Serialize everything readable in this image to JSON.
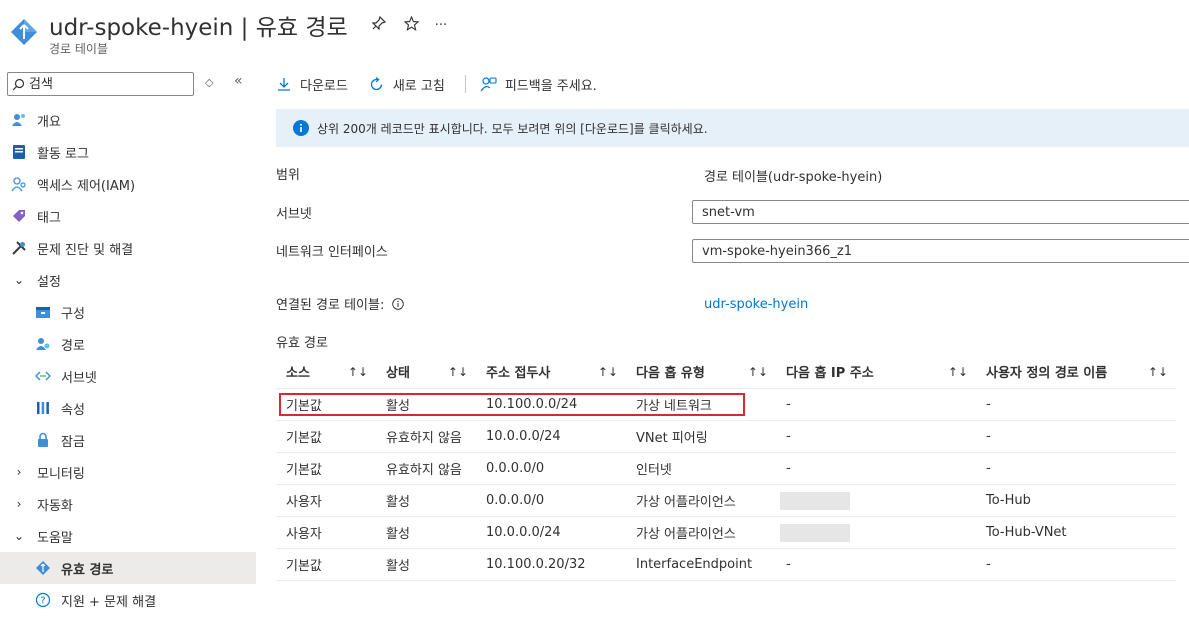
{
  "header": {
    "title": "udr-spoke-hyein | 유효 경로",
    "subtitle": "경로 테이블",
    "pin_icon": "pin-icon",
    "favorite_icon": "star-icon",
    "more": "···"
  },
  "sidebar": {
    "search_placeholder": "검색",
    "collapse": "«",
    "expand_toggle": "◇",
    "items": [
      {
        "label": "개요",
        "icon": "overview-icon",
        "kind": "top"
      },
      {
        "label": "활동 로그",
        "icon": "activity-log-icon",
        "kind": "top"
      },
      {
        "label": "액세스 제어(IAM)",
        "icon": "iam-icon",
        "kind": "top"
      },
      {
        "label": "태그",
        "icon": "tag-icon",
        "kind": "top"
      },
      {
        "label": "문제 진단 및 해결",
        "icon": "wrench-icon",
        "kind": "top"
      },
      {
        "label": "설정",
        "icon": "chevron-down-icon",
        "kind": "group"
      },
      {
        "label": "구성",
        "icon": "config-icon",
        "kind": "sub"
      },
      {
        "label": "경로",
        "icon": "routes-icon",
        "kind": "sub"
      },
      {
        "label": "서브넷",
        "icon": "subnet-icon",
        "kind": "sub"
      },
      {
        "label": "속성",
        "icon": "properties-icon",
        "kind": "sub"
      },
      {
        "label": "잠금",
        "icon": "lock-icon",
        "kind": "sub"
      },
      {
        "label": "모니터링",
        "icon": "chevron-right-icon",
        "kind": "group"
      },
      {
        "label": "자동화",
        "icon": "chevron-right-icon",
        "kind": "group"
      },
      {
        "label": "도움말",
        "icon": "chevron-down-icon",
        "kind": "group"
      },
      {
        "label": "유효 경로",
        "icon": "effective-routes-icon",
        "kind": "sub",
        "active": true
      },
      {
        "label": "지원 + 문제 해결",
        "icon": "help-icon",
        "kind": "sub"
      }
    ]
  },
  "toolbar": {
    "download": "다운로드",
    "refresh": "새로 고침",
    "feedback": "피드백을 주세요."
  },
  "info": {
    "text": "상위 200개 레코드만 표시합니다. 모두 보려면 위의 [다운로드]를 클릭하세요."
  },
  "form": {
    "scope_label": "범위",
    "scope_value": "경로 테이블(udr-spoke-hyein)",
    "subnet_label": "서브넷",
    "subnet_value": "snet-vm",
    "nic_label": "네트워크 인터페이스",
    "nic_value": "vm-spoke-hyein366_z1",
    "linked_label": "연결된 경로 테이블:",
    "linked_value": "udr-spoke-hyein",
    "section_title": "유효 경로"
  },
  "table": {
    "columns": [
      "소스",
      "상태",
      "주소 접두사",
      "다음 홉 유형",
      "다음 홉 IP 주소",
      "사용자 정의 경로 이름"
    ],
    "sort_glyph": "↑↓",
    "rows": [
      {
        "source": "기본값",
        "state": "활성",
        "prefix": "10.100.0.0/24",
        "next_hop_type": "가상 네트워크",
        "next_hop_ip": "-",
        "udr_name": "-",
        "redacted": false
      },
      {
        "source": "기본값",
        "state": "유효하지 않음",
        "prefix": "10.0.0.0/24",
        "next_hop_type": "VNet 피어링",
        "next_hop_ip": "-",
        "udr_name": "-",
        "redacted": false
      },
      {
        "source": "기본값",
        "state": "유효하지 않음",
        "prefix": "0.0.0.0/0",
        "next_hop_type": "인터넷",
        "next_hop_ip": "-",
        "udr_name": "-",
        "redacted": false
      },
      {
        "source": "사용자",
        "state": "활성",
        "prefix": "0.0.0.0/0",
        "next_hop_type": "가상 어플라이언스",
        "next_hop_ip": "",
        "udr_name": "To-Hub",
        "redacted": true
      },
      {
        "source": "사용자",
        "state": "활성",
        "prefix": "10.0.0.0/24",
        "next_hop_type": "가상 어플라이언스",
        "next_hop_ip": "",
        "udr_name": "To-Hub-VNet",
        "redacted": true
      },
      {
        "source": "기본값",
        "state": "활성",
        "prefix": "10.100.0.20/32",
        "next_hop_type": "InterfaceEndpoint",
        "next_hop_ip": "-",
        "udr_name": "-",
        "redacted": false
      }
    ]
  },
  "colors": {
    "accent": "#0078d4",
    "info_bg": "#e5f0f8",
    "highlight": "#d42c2c"
  }
}
